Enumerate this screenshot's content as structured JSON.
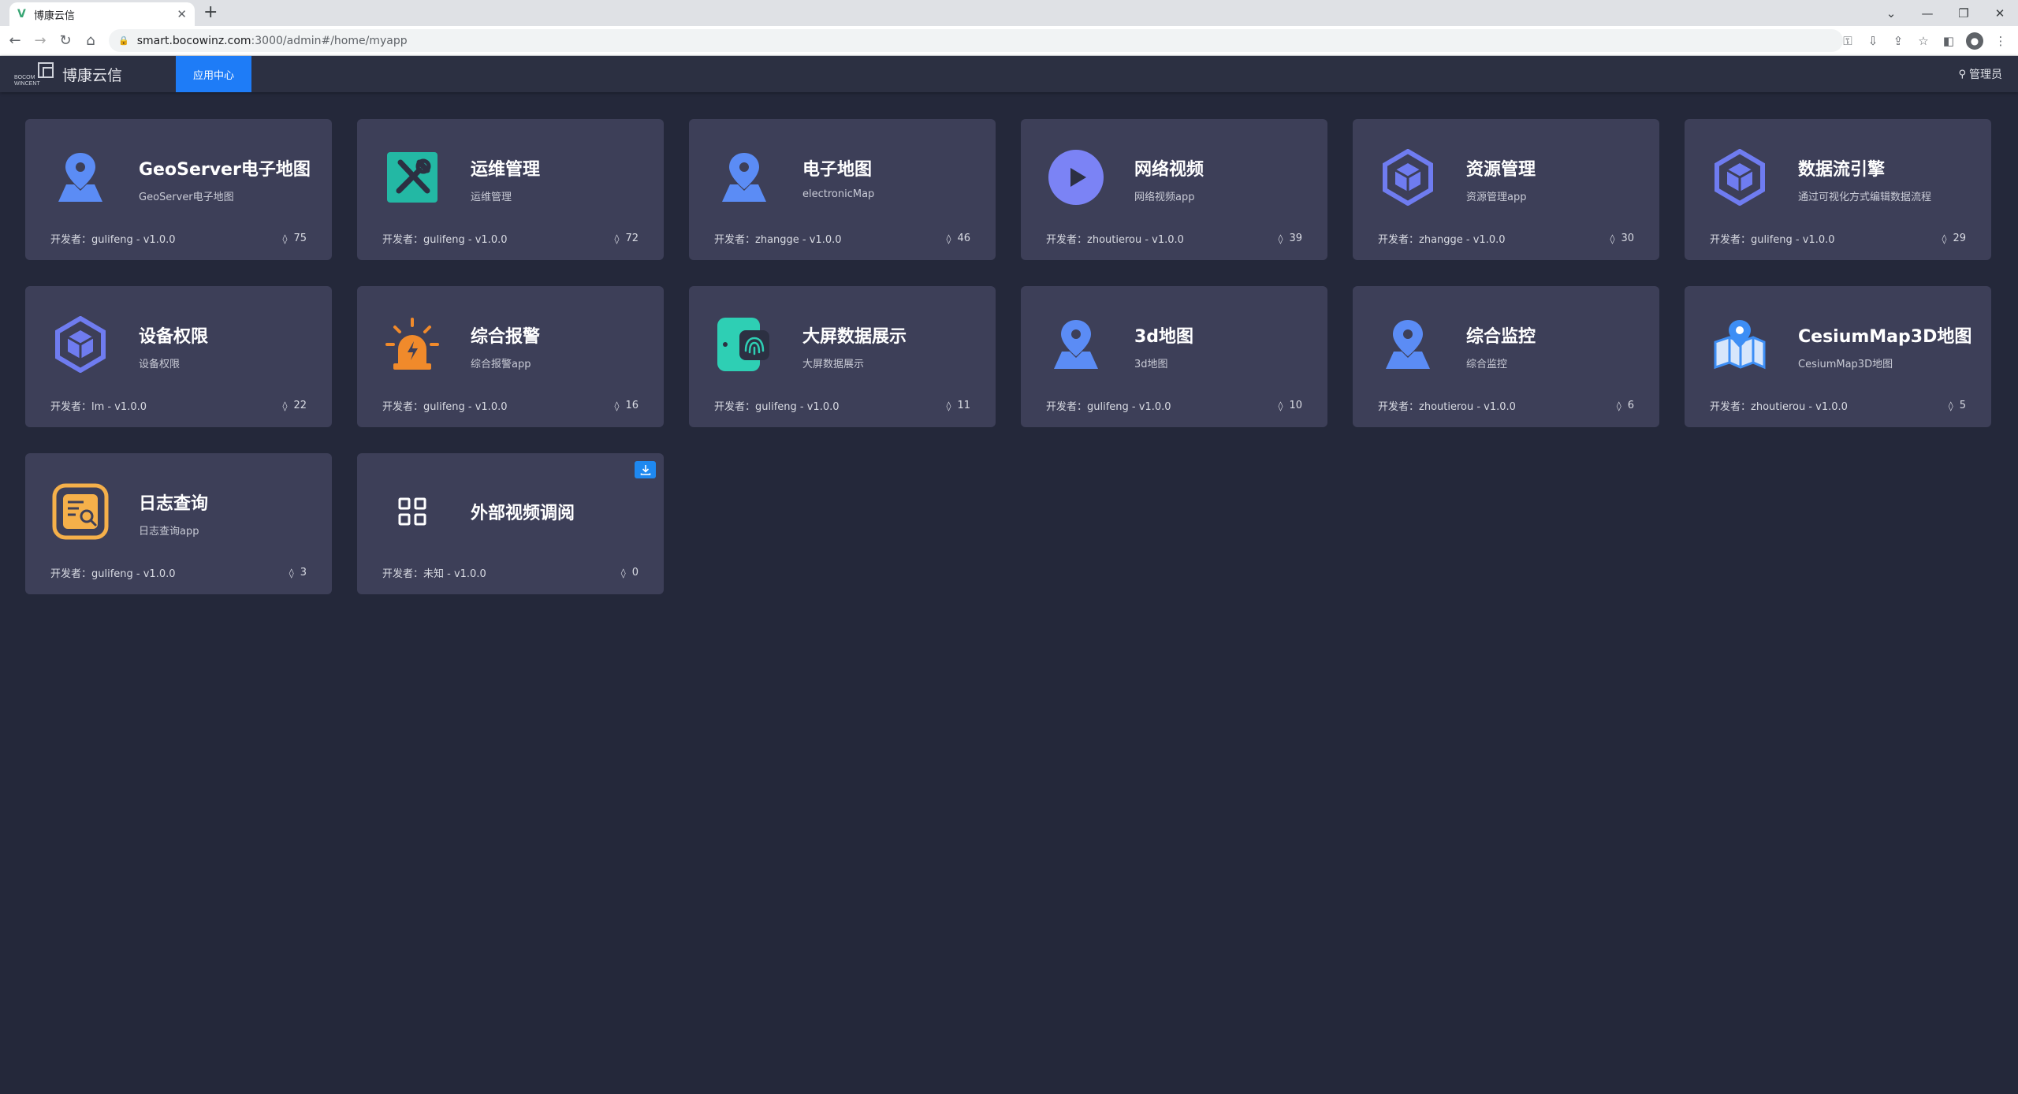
{
  "browser": {
    "tab_title": "博康云信",
    "tab_favicon": "V",
    "url_host": "smart.bocowinz.com",
    "url_path": ":3000/admin#/home/myapp"
  },
  "header": {
    "logo_text": "BOCOM WINCENT",
    "brand": "博康云信",
    "nav_active": "应用中心",
    "user": "管理员"
  },
  "cards": [
    {
      "title": "GeoServer电子地图",
      "desc": "GeoServer电子地图",
      "footer": "开发者：gulifeng - v1.0.0",
      "count": "75",
      "icon": "map-pin-icon",
      "color": "#5b8cf5"
    },
    {
      "title": "运维管理",
      "desc": "运维管理",
      "footer": "开发者：gulifeng - v1.0.0",
      "count": "72",
      "icon": "tools-icon",
      "color": "#23b8a4"
    },
    {
      "title": "电子地图",
      "desc": "electronicMap",
      "footer": "开发者：zhangge - v1.0.0",
      "count": "46",
      "icon": "map-pin-icon",
      "color": "#5b8cf5"
    },
    {
      "title": "网络视频",
      "desc": "网络视频app",
      "footer": "开发者：zhoutierou - v1.0.0",
      "count": "39",
      "icon": "play-icon",
      "color": "#7b83f5"
    },
    {
      "title": "资源管理",
      "desc": "资源管理app",
      "footer": "开发者：zhangge - v1.0.0",
      "count": "30",
      "icon": "cube-icon",
      "color": "#6f7cf0"
    },
    {
      "title": "数据流引擎",
      "desc": "通过可视化方式编辑数据流程",
      "footer": "开发者：gulifeng - v1.0.0",
      "count": "29",
      "icon": "cube-icon",
      "color": "#6f7cf0"
    },
    {
      "title": "设备权限",
      "desc": "设备权限",
      "footer": "开发者：lm - v1.0.0",
      "count": "22",
      "icon": "cube-icon",
      "color": "#6f7cf0"
    },
    {
      "title": "综合报警",
      "desc": "综合报警app",
      "footer": "开发者：gulifeng - v1.0.0",
      "count": "16",
      "icon": "alarm-icon",
      "color": "#f08a2b"
    },
    {
      "title": "大屏数据展示",
      "desc": "大屏数据展示",
      "footer": "开发者：gulifeng - v1.0.0",
      "count": "11",
      "icon": "fingerprint-icon",
      "color": "#2ecfb4"
    },
    {
      "title": "3d地图",
      "desc": "3d地图",
      "footer": "开发者：gulifeng - v1.0.0",
      "count": "10",
      "icon": "map-pin-icon",
      "color": "#5b8cf5"
    },
    {
      "title": "综合监控",
      "desc": "综合监控",
      "footer": "开发者：zhoutierou - v1.0.0",
      "count": "6",
      "icon": "map-pin-icon",
      "color": "#5b8cf5"
    },
    {
      "title": "CesiumMap3D地图",
      "desc": "CesiumMap3D地图",
      "footer": "开发者：zhoutierou - v1.0.0",
      "count": "5",
      "icon": "folded-map-icon",
      "color": "#3d8ef5"
    },
    {
      "title": "日志查询",
      "desc": "日志查询app",
      "footer": "开发者：gulifeng - v1.0.0",
      "count": "3",
      "icon": "log-search-icon",
      "color": "#f5b04a"
    },
    {
      "title": "外部视频调阅",
      "desc": "",
      "footer": "开发者：未知 - v1.0.0",
      "count": "0",
      "icon": "grid-icon",
      "color": "#ffffff"
    }
  ]
}
